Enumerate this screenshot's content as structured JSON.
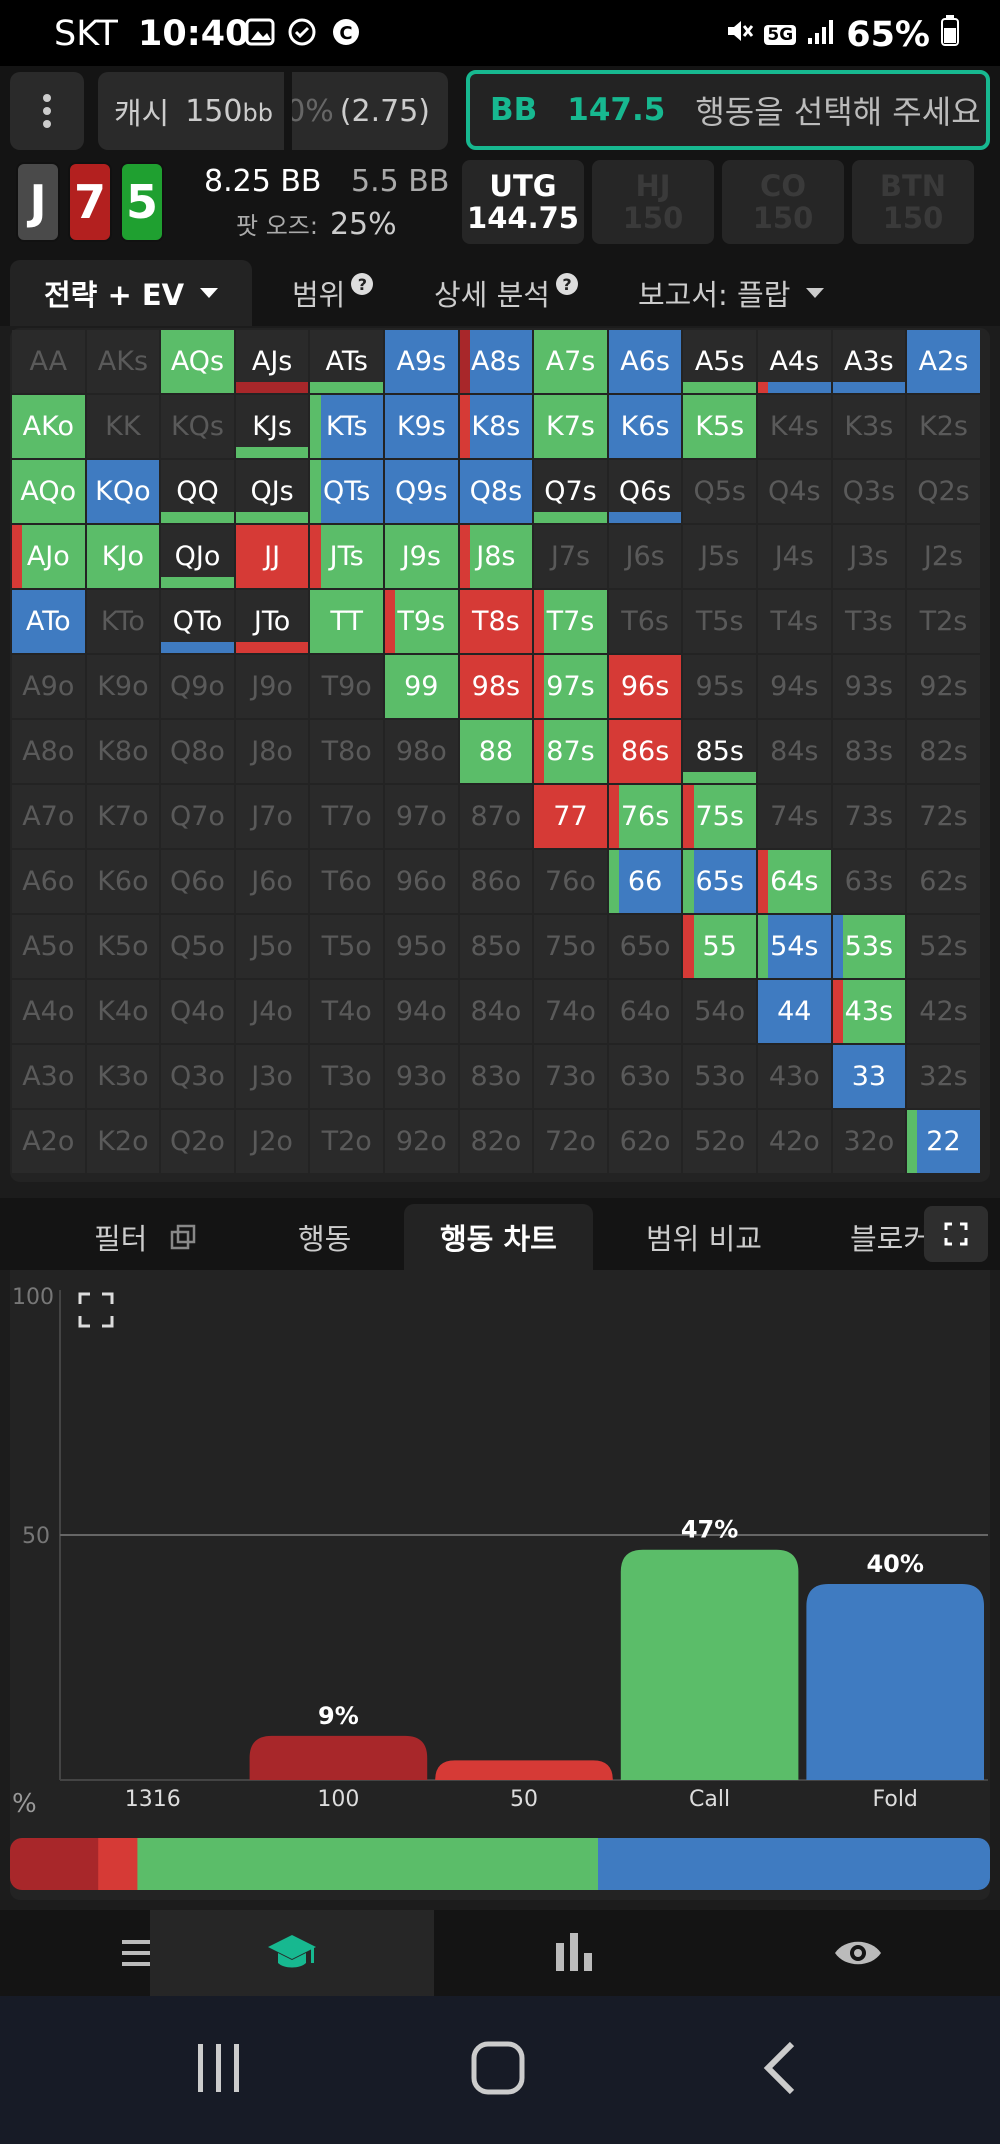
{
  "status_bar": {
    "carrier": "SKT",
    "time": "10:40",
    "battery": "65%",
    "network": "5G"
  },
  "header": {
    "cash_label": "캐시",
    "cash_value": "150",
    "cash_unit": "bb",
    "sizing_faded": "0%",
    "sizing_value": "(2.75)",
    "bb_label": "BB",
    "bb_stack": "147.5",
    "bb_prompt": "행동을 선택해 주세요"
  },
  "board": {
    "cards": [
      {
        "rank": "J",
        "color": "#4a4a4a"
      },
      {
        "rank": "7",
        "color": "#b3201f"
      },
      {
        "rank": "5",
        "color": "#1fa030"
      }
    ],
    "pot": "8.25 BB",
    "pot_sub": "5.5 BB",
    "odds_label": "팟 오즈:",
    "odds_value": "25%"
  },
  "positions": [
    {
      "name": "UTG",
      "stack": "144.75",
      "active": true
    },
    {
      "name": "HJ",
      "stack": "150",
      "active": false
    },
    {
      "name": "CO",
      "stack": "150",
      "active": false
    },
    {
      "name": "BTN",
      "stack": "150",
      "active": false
    }
  ],
  "tabs": {
    "strategy": "전략 + EV",
    "range": "범위",
    "analysis": "상세 분석",
    "report": "보고서: 플랍"
  },
  "colors": {
    "bet_big": "#a8272a",
    "bet_small": "#d63a36",
    "call": "#5bbd69",
    "fold": "#3f7bc1",
    "accent": "#17b890"
  },
  "matrix": {
    "ranks": [
      "A",
      "K",
      "Q",
      "J",
      "T",
      "9",
      "8",
      "7",
      "6",
      "5",
      "4",
      "3",
      "2"
    ],
    "cells": [
      [
        "AA",
        "-"
      ],
      [
        "AKs",
        "-"
      ],
      [
        "AQs",
        "c"
      ],
      [
        "AJs",
        "b|rc"
      ],
      [
        "ATs",
        "c|bc"
      ],
      [
        "A9s",
        "f"
      ],
      [
        "A8s",
        "bf"
      ],
      [
        "A7s",
        "c"
      ],
      [
        "A6s",
        "f"
      ],
      [
        "A5s",
        "c|cf"
      ],
      [
        "A4s",
        "rf|rcf"
      ],
      [
        "A3s",
        "f|f"
      ],
      [
        "A2s",
        "f"
      ],
      [
        "AKo",
        "c"
      ],
      [
        "KK",
        "-"
      ],
      [
        "KQs",
        "-"
      ],
      [
        "KJs",
        "c|rc"
      ],
      [
        "KTs",
        "cf"
      ],
      [
        "K9s",
        "f"
      ],
      [
        "K8s",
        "rf"
      ],
      [
        "K7s",
        "c"
      ],
      [
        "K6s",
        "f"
      ],
      [
        "K5s",
        "c"
      ],
      [
        "K4s",
        "-"
      ],
      [
        "K3s",
        "-"
      ],
      [
        "K2s",
        "-"
      ],
      [
        "AQo",
        "c"
      ],
      [
        "KQo",
        "f"
      ],
      [
        "QQ",
        "c|c"
      ],
      [
        "QJs",
        "c|rc"
      ],
      [
        "QTs",
        "cf"
      ],
      [
        "Q9s",
        "f"
      ],
      [
        "Q8s",
        "f"
      ],
      [
        "Q7s",
        "c|c"
      ],
      [
        "Q6s",
        "f|f"
      ],
      [
        "Q5s",
        "-"
      ],
      [
        "Q4s",
        "-"
      ],
      [
        "Q3s",
        "-"
      ],
      [
        "Q2s",
        "-"
      ],
      [
        "AJo",
        "rc"
      ],
      [
        "KJo",
        "c"
      ],
      [
        "QJo",
        "c|c"
      ],
      [
        "JJ",
        "r"
      ],
      [
        "JTs",
        "rc"
      ],
      [
        "J9s",
        "c"
      ],
      [
        "J8s",
        "rc"
      ],
      [
        "J7s",
        "-"
      ],
      [
        "J6s",
        "-"
      ],
      [
        "J5s",
        "-"
      ],
      [
        "J4s",
        "-"
      ],
      [
        "J3s",
        "-"
      ],
      [
        "J2s",
        "-"
      ],
      [
        "ATo",
        "f"
      ],
      [
        "KTo",
        "-"
      ],
      [
        "QTo",
        "f|f"
      ],
      [
        "JTo",
        "r|r"
      ],
      [
        "TT",
        "c"
      ],
      [
        "T9s",
        "rc"
      ],
      [
        "T8s",
        "r"
      ],
      [
        "T7s",
        "rc"
      ],
      [
        "T6s",
        "-"
      ],
      [
        "T5s",
        "-"
      ],
      [
        "T4s",
        "-"
      ],
      [
        "T3s",
        "-"
      ],
      [
        "T2s",
        "-"
      ],
      [
        "A9o",
        "-"
      ],
      [
        "K9o",
        "-"
      ],
      [
        "Q9o",
        "-"
      ],
      [
        "J9o",
        "-"
      ],
      [
        "T9o",
        "-"
      ],
      [
        "99",
        "c"
      ],
      [
        "98s",
        "r"
      ],
      [
        "97s",
        "rc"
      ],
      [
        "96s",
        "r"
      ],
      [
        "95s",
        "-"
      ],
      [
        "94s",
        "-"
      ],
      [
        "93s",
        "-"
      ],
      [
        "92s",
        "-"
      ],
      [
        "A8o",
        "-"
      ],
      [
        "K8o",
        "-"
      ],
      [
        "Q8o",
        "-"
      ],
      [
        "J8o",
        "-"
      ],
      [
        "T8o",
        "-"
      ],
      [
        "98o",
        "-"
      ],
      [
        "88",
        "c"
      ],
      [
        "87s",
        "rc"
      ],
      [
        "86s",
        "r"
      ],
      [
        "85s",
        "c|c"
      ],
      [
        "84s",
        "-"
      ],
      [
        "83s",
        "-"
      ],
      [
        "82s",
        "-"
      ],
      [
        "A7o",
        "-"
      ],
      [
        "K7o",
        "-"
      ],
      [
        "Q7o",
        "-"
      ],
      [
        "J7o",
        "-"
      ],
      [
        "T7o",
        "-"
      ],
      [
        "97o",
        "-"
      ],
      [
        "87o",
        "-"
      ],
      [
        "77",
        "r"
      ],
      [
        "76s",
        "rc"
      ],
      [
        "75s",
        "rc"
      ],
      [
        "74s",
        "-"
      ],
      [
        "73s",
        "-"
      ],
      [
        "72s",
        "-"
      ],
      [
        "A6o",
        "-"
      ],
      [
        "K6o",
        "-"
      ],
      [
        "Q6o",
        "-"
      ],
      [
        "J6o",
        "-"
      ],
      [
        "T6o",
        "-"
      ],
      [
        "96o",
        "-"
      ],
      [
        "86o",
        "-"
      ],
      [
        "76o",
        "-"
      ],
      [
        "66",
        "cf"
      ],
      [
        "65s",
        "cf"
      ],
      [
        "64s",
        "rc"
      ],
      [
        "63s",
        "-"
      ],
      [
        "62s",
        "-"
      ],
      [
        "A5o",
        "-"
      ],
      [
        "K5o",
        "-"
      ],
      [
        "Q5o",
        "-"
      ],
      [
        "J5o",
        "-"
      ],
      [
        "T5o",
        "-"
      ],
      [
        "95o",
        "-"
      ],
      [
        "85o",
        "-"
      ],
      [
        "75o",
        "-"
      ],
      [
        "65o",
        "-"
      ],
      [
        "55",
        "rc"
      ],
      [
        "54s",
        "cf"
      ],
      [
        "53s",
        "fc"
      ],
      [
        "52s",
        "-"
      ],
      [
        "A4o",
        "-"
      ],
      [
        "K4o",
        "-"
      ],
      [
        "Q4o",
        "-"
      ],
      [
        "J4o",
        "-"
      ],
      [
        "T4o",
        "-"
      ],
      [
        "94o",
        "-"
      ],
      [
        "84o",
        "-"
      ],
      [
        "74o",
        "-"
      ],
      [
        "64o",
        "-"
      ],
      [
        "54o",
        "-"
      ],
      [
        "44",
        "f"
      ],
      [
        "43s",
        "rc"
      ],
      [
        "42s",
        "-"
      ],
      [
        "A3o",
        "-"
      ],
      [
        "K3o",
        "-"
      ],
      [
        "Q3o",
        "-"
      ],
      [
        "J3o",
        "-"
      ],
      [
        "T3o",
        "-"
      ],
      [
        "93o",
        "-"
      ],
      [
        "83o",
        "-"
      ],
      [
        "73o",
        "-"
      ],
      [
        "63o",
        "-"
      ],
      [
        "53o",
        "-"
      ],
      [
        "43o",
        "-"
      ],
      [
        "33",
        "f"
      ],
      [
        "32s",
        "-"
      ],
      [
        "A2o",
        "-"
      ],
      [
        "K2o",
        "-"
      ],
      [
        "Q2o",
        "-"
      ],
      [
        "J2o",
        "-"
      ],
      [
        "T2o",
        "-"
      ],
      [
        "92o",
        "-"
      ],
      [
        "82o",
        "-"
      ],
      [
        "72o",
        "-"
      ],
      [
        "62o",
        "-"
      ],
      [
        "52o",
        "-"
      ],
      [
        "42o",
        "-"
      ],
      [
        "32o",
        "-"
      ],
      [
        "22",
        "cf"
      ]
    ]
  },
  "bottom_tabs": {
    "filter": "필터",
    "action": "행동",
    "action_chart": "행동 차트",
    "range_compare": "범위 비교",
    "blocker": "블로커"
  },
  "chart_data": {
    "type": "bar",
    "categories": [
      "1316",
      "100",
      "50",
      "Call",
      "Fold"
    ],
    "values": [
      0,
      9,
      4,
      47,
      40
    ],
    "data_labels": [
      "",
      "9%",
      "",
      "47%",
      "40%"
    ],
    "colors": [
      "#a8272a",
      "#a8272a",
      "#d63a36",
      "#5bbd69",
      "#3f7bc1"
    ],
    "ylim": [
      0,
      100
    ],
    "yticks": [
      "100",
      "50"
    ],
    "ylabel": "%",
    "summary_bar": [
      {
        "value": 9,
        "color": "#a8272a"
      },
      {
        "value": 4,
        "color": "#d63a36"
      },
      {
        "value": 47,
        "color": "#5bbd69"
      },
      {
        "value": 40,
        "color": "#3f7bc1"
      }
    ]
  },
  "nav": [
    {
      "icon": "menu-icon"
    },
    {
      "icon": "study-icon",
      "selected": true
    },
    {
      "icon": "stats-icon"
    },
    {
      "icon": "view-icon"
    }
  ]
}
